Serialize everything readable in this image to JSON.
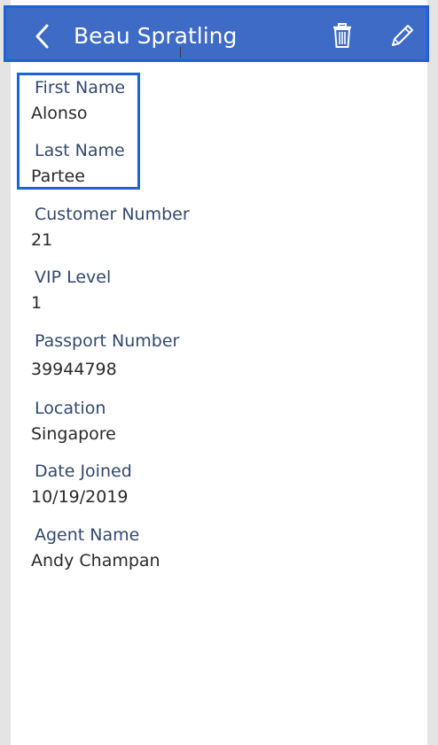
{
  "header": {
    "title": "Beau Spratling",
    "background_color": "#3d6bc5",
    "back_icon": "chevron-left-icon",
    "delete_icon": "trash-icon",
    "edit_icon": "pencil-icon"
  },
  "fields": [
    {
      "label": "First Name",
      "value": "Alonso"
    },
    {
      "label": "Last Name",
      "value": "Partee"
    },
    {
      "label": "Customer Number",
      "value": "21"
    },
    {
      "label": "VIP Level",
      "value": "1"
    },
    {
      "label": "Passport Number",
      "value": "39944798"
    },
    {
      "label": "Location",
      "value": "Singapore"
    },
    {
      "label": "Date Joined",
      "value": "10/19/2019"
    },
    {
      "label": "Agent Name",
      "value": "Andy Champan"
    }
  ],
  "colors": {
    "label": "#33496d",
    "value": "#2a2a2a",
    "selection_outline": "#1c63d6"
  }
}
